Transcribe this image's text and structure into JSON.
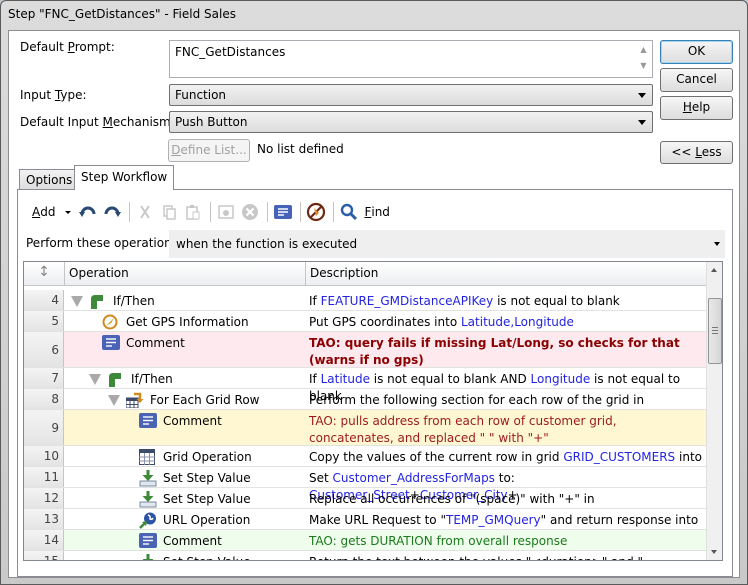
{
  "window": {
    "title": "Step \"FNC_GetDistances\" - Field Sales"
  },
  "form": {
    "prompt_label_pre": "Default ",
    "prompt_label_u": "P",
    "prompt_label_post": "rompt:",
    "prompt_value": "FNC_GetDistances",
    "input_type_label_pre": "Input ",
    "input_type_label_u": "T",
    "input_type_label_post": "ype:",
    "input_type_value": "Function",
    "mechanism_label_pre": "Default Input ",
    "mechanism_label_u": "M",
    "mechanism_label_post": "echanism:",
    "mechanism_value": "Push Button",
    "define_list_u": "D",
    "define_list_rest": "efine List...",
    "no_list_text": "No list defined"
  },
  "buttons": {
    "ok": "OK",
    "cancel": "Cancel",
    "help_u": "H",
    "help_rest": "elp",
    "less_pre": "<< ",
    "less_u": "L",
    "less_rest": "ess"
  },
  "tabs": [
    {
      "label": "Options",
      "active": false
    },
    {
      "label": "Step Workflow",
      "active": true
    }
  ],
  "toolbar": {
    "add_u": "A",
    "add_rest": "dd",
    "find_u": "F",
    "find_rest": "ind",
    "icons": [
      "undo-icon",
      "redo-icon",
      "cut-icon",
      "copy-icon",
      "paste-icon",
      "settings-icon",
      "delete-icon",
      "comment-icon",
      "disable-icon",
      "find-icon"
    ]
  },
  "perform": {
    "label": "Perform these operations",
    "value": "when the function is executed"
  },
  "grid": {
    "columns": {
      "sort": "↕",
      "operation": "Operation",
      "description": "Description"
    },
    "rows": [
      {
        "num": "4",
        "indent": 0,
        "expander": true,
        "icon": "if-then-icon",
        "op": "If/Then",
        "bg": "",
        "desc": [
          [
            "t",
            "If "
          ],
          [
            "v",
            "FEATURE_GMDistanceAPIKey"
          ],
          [
            "t",
            " is not equal to blank"
          ]
        ]
      },
      {
        "num": "5",
        "indent": 1,
        "expander": false,
        "icon": "gps-icon",
        "op": "Get GPS Information",
        "bg": "",
        "desc": [
          [
            "t",
            "Put GPS coordinates into "
          ],
          [
            "v",
            "Latitude,Longitude"
          ]
        ]
      },
      {
        "num": "6",
        "indent": 1,
        "expander": false,
        "icon": "comment-icon",
        "op": "Comment",
        "bg": "pink",
        "tall": true,
        "desc": [
          [
            "rb",
            "TAO:  query fails if missing Lat/Long, so checks for that (warns if no gps)"
          ]
        ]
      },
      {
        "num": "7",
        "indent": 1,
        "expander": true,
        "icon": "if-then-icon",
        "op": "If/Then",
        "bg": "",
        "desc": [
          [
            "t",
            "If "
          ],
          [
            "v",
            "Latitude"
          ],
          [
            "t",
            " is not equal to blank AND "
          ],
          [
            "v",
            "Longitude"
          ],
          [
            "t",
            " is not equal to blank"
          ]
        ]
      },
      {
        "num": "8",
        "indent": 2,
        "expander": true,
        "icon": "for-each-grid-row-icon",
        "op": "For Each Grid Row",
        "bg": "",
        "desc": [
          [
            "t",
            "Perform the following section for each row of the grid in"
          ]
        ]
      },
      {
        "num": "9",
        "indent": 3,
        "expander": false,
        "icon": "comment-icon",
        "op": "Comment",
        "bg": "yellow",
        "tall": true,
        "desc": [
          [
            "dr",
            "TAO:  pulls address from each row of customer grid, concatenates, and replaced \" \" with \"+\""
          ]
        ]
      },
      {
        "num": "10",
        "indent": 3,
        "expander": false,
        "icon": "grid-operation-icon",
        "op": "Grid Operation",
        "bg": "",
        "desc": [
          [
            "t",
            "Copy the values of the current row in grid "
          ],
          [
            "v",
            "GRID_CUSTOMERS"
          ],
          [
            "t",
            " into"
          ]
        ]
      },
      {
        "num": "11",
        "indent": 3,
        "expander": false,
        "icon": "set-step-value-icon",
        "op": "Set Step Value",
        "bg": "",
        "desc": [
          [
            "t",
            "Set "
          ],
          [
            "v",
            "Customer_AddressForMaps"
          ],
          [
            "t",
            " to: "
          ],
          [
            "v",
            "Customer_Street"
          ],
          [
            "t",
            "+"
          ],
          [
            "v",
            "Customer_City"
          ],
          [
            "t",
            "+"
          ]
        ]
      },
      {
        "num": "12",
        "indent": 3,
        "expander": false,
        "icon": "set-step-value-icon",
        "op": "Set Step Value",
        "bg": "",
        "desc": [
          [
            "t",
            "Replace all occurrences of \"(space)\" with \"+\" in"
          ]
        ]
      },
      {
        "num": "13",
        "indent": 3,
        "expander": false,
        "icon": "url-operation-icon",
        "op": "URL Operation",
        "bg": "",
        "desc": [
          [
            "t",
            "Make URL Request to \""
          ],
          [
            "v",
            "TEMP_GMQuery"
          ],
          [
            "t",
            "\" and return response into"
          ]
        ]
      },
      {
        "num": "14",
        "indent": 3,
        "expander": false,
        "icon": "comment-icon",
        "op": "Comment",
        "bg": "green",
        "desc": [
          [
            "g",
            "TAO: gets DURATION from overall response"
          ]
        ]
      },
      {
        "num": "15",
        "indent": 3,
        "expander": false,
        "icon": "set-step-value-icon",
        "op": "Set Step Value",
        "bg": "",
        "desc": [
          [
            "t",
            "Return the text between the values \"<duration>\" and \"</duration>\""
          ]
        ]
      }
    ]
  }
}
